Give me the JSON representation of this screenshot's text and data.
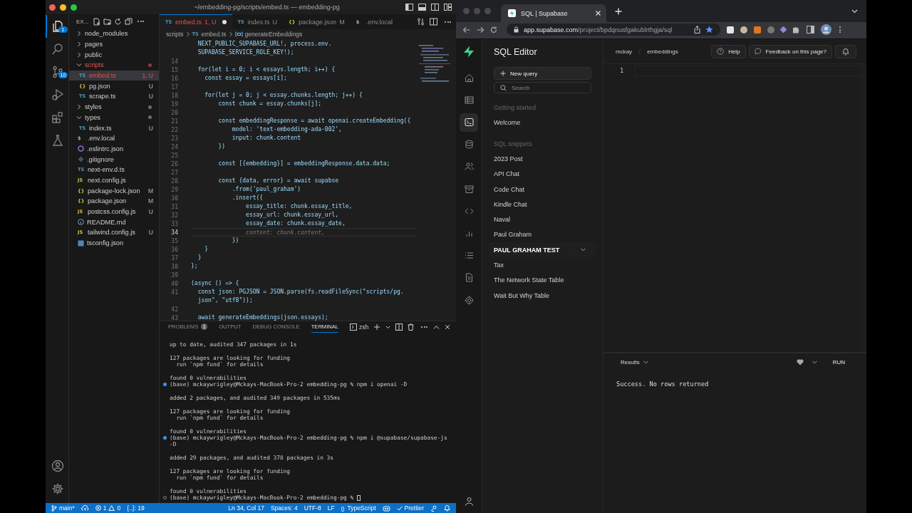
{
  "vscode": {
    "title": "~/embedding-pg/scripts/embed.ts — embedding-pg",
    "activity": [
      {
        "kind": "files",
        "badge": "1",
        "selected": true
      },
      {
        "kind": "search",
        "selected": false
      },
      {
        "kind": "source-control",
        "badge": "10",
        "selected": false
      },
      {
        "kind": "run-debug",
        "selected": false
      },
      {
        "kind": "extensions",
        "selected": false
      },
      {
        "kind": "flask",
        "selected": false
      }
    ],
    "activity_bottom": [
      {
        "kind": "account"
      },
      {
        "kind": "settings"
      }
    ],
    "explorer": {
      "header": "EX...",
      "tree": [
        {
          "name": "node_modules",
          "kind": "folder",
          "expanded": false,
          "dot": false,
          "error": false,
          "selected": false
        },
        {
          "name": "pages",
          "kind": "folder",
          "expanded": false,
          "dot": false,
          "error": false,
          "selected": false
        },
        {
          "name": "public",
          "kind": "folder",
          "expanded": false,
          "dot": false,
          "error": false,
          "selected": false
        },
        {
          "name": "scripts",
          "kind": "folder",
          "expanded": true,
          "dot": true,
          "error": true,
          "selected": false,
          "children": [
            {
              "name": "embed.ts",
              "kind": "ts",
              "glyph": "TS",
              "status": "1, U",
              "error": true,
              "selected": true
            },
            {
              "name": "pg.json",
              "kind": "json",
              "glyph": "{}",
              "status": "U",
              "error": false,
              "selected": false
            },
            {
              "name": "scrape.ts",
              "kind": "ts",
              "glyph": "TS",
              "status": "U",
              "error": false,
              "selected": false
            }
          ]
        },
        {
          "name": "styles",
          "kind": "folder",
          "expanded": false,
          "dot": true,
          "error": false,
          "selected": false
        },
        {
          "name": "types",
          "kind": "folder",
          "expanded": true,
          "dot": true,
          "error": false,
          "selected": false,
          "children": [
            {
              "name": "index.ts",
              "kind": "ts",
              "glyph": "TS",
              "status": "U",
              "error": false,
              "selected": false
            }
          ]
        },
        {
          "name": ".env.local",
          "kind": "env",
          "glyph": "$",
          "error": false,
          "selected": false
        },
        {
          "name": ".eslintrc.json",
          "kind": "eslint",
          "error": false,
          "selected": false
        },
        {
          "name": ".gitignore",
          "kind": "git",
          "error": false,
          "selected": false
        },
        {
          "name": "next-env.d.ts",
          "kind": "ts",
          "glyph": "TS",
          "error": false,
          "selected": false
        },
        {
          "name": "next.config.js",
          "kind": "js",
          "glyph": "JS",
          "error": false,
          "selected": false
        },
        {
          "name": "package-lock.json",
          "kind": "json",
          "glyph": "{}",
          "status": "M",
          "error": false,
          "selected": false
        },
        {
          "name": "package.json",
          "kind": "json",
          "glyph": "{}",
          "status": "M",
          "error": false,
          "selected": false
        },
        {
          "name": "postcss.config.js",
          "kind": "js",
          "glyph": "JS",
          "status": "U",
          "error": false,
          "selected": false
        },
        {
          "name": "README.md",
          "kind": "info",
          "error": false,
          "selected": false
        },
        {
          "name": "tailwind.config.js",
          "kind": "js",
          "glyph": "JS",
          "status": "U",
          "error": false,
          "selected": false
        },
        {
          "name": "tsconfig.json",
          "kind": "tsconfig",
          "error": false,
          "selected": false
        }
      ]
    },
    "tabs": [
      {
        "label": "embed.ts",
        "kind": "ts",
        "glyph": "TS",
        "status": "1, U",
        "selected": true,
        "error": true,
        "dirty": true
      },
      {
        "label": "index.ts",
        "kind": "ts",
        "glyph": "TS",
        "status": "U",
        "selected": false,
        "error": false,
        "dirty": false
      },
      {
        "label": "package.json",
        "kind": "json",
        "glyph": "{}",
        "status": "M",
        "selected": false,
        "error": false,
        "dirty": false
      },
      {
        "label": ".env.local",
        "kind": "env",
        "glyph": "$",
        "selected": false,
        "error": false,
        "dirty": false
      }
    ],
    "breadcrumb": {
      "folder": "scripts",
      "file_glyph": "TS",
      "file": "embed.ts",
      "symbol": "generateEmbeddings"
    },
    "editor": {
      "lines": [
        {
          "text": "  NEXT_PUBLIC_SUPABASE_URL!, process.env.",
          "kind": "code",
          "current": false
        },
        {
          "text": "  SUPABASE_SERVICE_ROLE_KEY!);",
          "kind": "code",
          "current": false
        },
        {
          "number": "14",
          "current": false
        },
        {
          "number": "15",
          "text": "  for(let i = 0; i < essays.length; i++) {",
          "kind": "code",
          "current": false
        },
        {
          "number": "16",
          "text": "    const essay = essays[i];",
          "kind": "code",
          "current": false
        },
        {
          "number": "17",
          "current": false
        },
        {
          "number": "18",
          "text": "    for(let j = 0; j < essay.chunks.length; j++) {",
          "kind": "code",
          "current": false
        },
        {
          "number": "19",
          "text": "        const chunk = essay.chunks[j];",
          "kind": "code",
          "current": false
        },
        {
          "number": "20",
          "current": false
        },
        {
          "number": "21",
          "text": "        const embeddingResponse = await openai.createEmbedding({",
          "kind": "code",
          "current": false
        },
        {
          "number": "22",
          "text": "            model: 'text-embedding-ada-002',",
          "kind": "code",
          "current": false
        },
        {
          "number": "23",
          "text": "            input: chunk.content",
          "kind": "code",
          "current": false
        },
        {
          "number": "24",
          "text": "        })",
          "kind": "code",
          "current": false
        },
        {
          "number": "25",
          "current": false
        },
        {
          "number": "26",
          "text": "        const [{embedding}] = embeddingResponse.data.data;",
          "kind": "code",
          "current": false
        },
        {
          "number": "27",
          "current": false
        },
        {
          "number": "28",
          "text": "        const {data, error} = await supabse",
          "kind": "code",
          "current": false
        },
        {
          "number": "29",
          "text": "            .from('paul_graham')",
          "kind": "code",
          "current": false
        },
        {
          "number": "30",
          "text": "            .insert({",
          "kind": "code",
          "current": false
        },
        {
          "number": "31",
          "text": "                essay_title: chunk.essay_title,",
          "kind": "code",
          "current": false
        },
        {
          "number": "32",
          "text": "                essay_url: chunk.essay_url,",
          "kind": "code",
          "current": false
        },
        {
          "number": "33",
          "text": "                essay_date: chunk.essay_date,",
          "kind": "code",
          "current": false
        },
        {
          "number": "34",
          "text": "                content: chunk.content,",
          "kind": "suggestion",
          "current": true
        },
        {
          "number": "35",
          "text": "            })",
          "kind": "code",
          "current": false
        },
        {
          "number": "36",
          "text": "    }",
          "kind": "code",
          "current": false
        },
        {
          "number": "37",
          "text": "  }",
          "kind": "code",
          "current": false
        },
        {
          "number": "38",
          "text": "};",
          "kind": "code",
          "current": false
        },
        {
          "number": "39",
          "current": false
        },
        {
          "number": "40",
          "text": "(async () => {",
          "kind": "code",
          "current": false
        },
        {
          "number": "41",
          "text": "  const json: PGJSON = JSON.parse(fs.readFileSync(\"scripts/pg.",
          "kind": "code",
          "current": false
        },
        {
          "text": "  json\", \"utf8\"));",
          "kind": "code",
          "current": false
        },
        {
          "number": "42",
          "current": false
        },
        {
          "number": "43",
          "text": "  await generateEmbeddings(json.essays);",
          "kind": "code",
          "current": false
        }
      ]
    },
    "panel": {
      "tabs": [
        {
          "label": "PROBLEMS",
          "badge": "1",
          "selected": false
        },
        {
          "label": "OUTPUT",
          "selected": false
        },
        {
          "label": "DEBUG CONSOLE",
          "selected": false
        },
        {
          "label": "TERMINAL",
          "selected": true
        }
      ],
      "shell": "zsh",
      "terminal": [
        [
          {
            "kind": "output",
            "text": "up to date, audited 347 packages in 1s"
          }
        ],
        [
          {
            "kind": "output",
            "text": "127 packages are looking for funding"
          },
          {
            "kind": "output",
            "text": "  run `npm fund` for details"
          }
        ],
        [
          {
            "kind": "output",
            "text": "found 0 vulnerabilities"
          },
          {
            "kind": "prompt_done",
            "text": "(base) mckaywrigley@Mckays-MacBook-Pro-2 embedding-pg % npm i openai -D"
          }
        ],
        [
          {
            "kind": "output",
            "text": "added 2 packages, and audited 349 packages in 535ms"
          }
        ],
        [
          {
            "kind": "output",
            "text": "127 packages are looking for funding"
          },
          {
            "kind": "output",
            "text": "  run `npm fund` for details"
          }
        ],
        [
          {
            "kind": "output",
            "text": "found 0 vulnerabilities"
          },
          {
            "kind": "prompt_done",
            "text": "(base) mckaywrigley@Mckays-MacBook-Pro-2 embedding-pg % npm i @supabase/supabase-js"
          },
          {
            "kind": "output",
            "text": "-D"
          }
        ],
        [
          {
            "kind": "output",
            "text": "added 29 packages, and audited 378 packages in 3s"
          }
        ],
        [
          {
            "kind": "output",
            "text": "127 packages are looking for funding"
          },
          {
            "kind": "output",
            "text": "  run `npm fund` for details"
          }
        ],
        [
          {
            "kind": "output",
            "text": "found 0 vulnerabilities"
          },
          {
            "kind": "prompt_active",
            "text": "(base) mckaywrigley@Mckays-MacBook-Pro-2 embedding-pg %"
          }
        ]
      ]
    },
    "status_bar": {
      "branch": "main*",
      "errors": "1",
      "warnings": "0",
      "symbols": "{..}: 19",
      "position": "Ln 34, Col 17",
      "indent": "Spaces: 4",
      "encoding": "UTF-8",
      "eol": "LF",
      "language_glyph": "{}",
      "language": "TypeScript",
      "formatter": "Prettier"
    }
  },
  "browser": {
    "tab": {
      "title": "SQL | Supabase"
    },
    "url": {
      "domain": "app.supabase.com",
      "path": "/project/bpdqnusfgakublrthgja/sql"
    },
    "supabase": {
      "rail": [
        {
          "kind": "home",
          "selected": false
        },
        {
          "kind": "table",
          "selected": false
        },
        {
          "kind": "sql",
          "selected": true
        },
        {
          "kind": "database",
          "selected": false
        },
        {
          "kind": "users",
          "selected": false
        },
        {
          "kind": "storage",
          "selected": false
        },
        {
          "kind": "code",
          "selected": false
        },
        {
          "kind": "reports",
          "selected": false
        },
        {
          "kind": "list",
          "selected": false
        },
        {
          "kind": "document",
          "selected": false
        },
        {
          "kind": "settings",
          "selected": false
        }
      ],
      "title": "SQL Editor",
      "new_query": "New query",
      "search": {
        "placeholder": "Search"
      },
      "sections": [
        {
          "heading": "Getting started",
          "items": [
            {
              "label": "Welcome",
              "selected": false
            }
          ]
        },
        {
          "heading": "SQL snippets",
          "items": [
            {
              "label": "2023 Post",
              "selected": false
            },
            {
              "label": "API Chat",
              "selected": false
            },
            {
              "label": "Code Chat",
              "selected": false
            },
            {
              "label": "Kindle Chat",
              "selected": false
            },
            {
              "label": "Naval",
              "selected": false
            },
            {
              "label": "Paul Graham",
              "selected": false
            },
            {
              "label": "PAUL GRAHAM TEST",
              "selected": true
            },
            {
              "label": "Tax",
              "selected": false
            },
            {
              "label": "The Network State Table",
              "selected": false
            },
            {
              "label": "Wait But Why Table",
              "selected": false
            }
          ]
        }
      ],
      "breadcrumb": [
        "mckay",
        "embeddings"
      ],
      "help": "Help",
      "feedback": "Feedback on this page?",
      "editor_lines": [
        "1"
      ],
      "results": {
        "label": "Results",
        "run": "RUN",
        "message": "Success. No rows returned"
      }
    }
  }
}
